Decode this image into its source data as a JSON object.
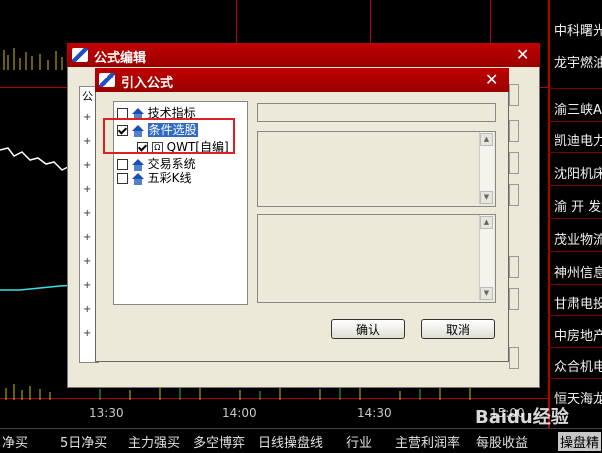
{
  "stock_list": [
    "中科曙光",
    "龙宇燃油",
    "渝三峡A",
    "凯迪电力",
    "沈阳机床",
    "渝 开 发",
    "茂业物流",
    "神州信息",
    "甘肃电投",
    "中房地产",
    "众合机电",
    "恒天海龙"
  ],
  "time_axis": [
    "13:30",
    "14:00",
    "14:30",
    "15:00"
  ],
  "bottom_tabs": [
    "净买",
    "5日净买",
    "主力强买",
    "多空博弈",
    "日线操盘线",
    "行业",
    "主营利润率",
    "每股收益",
    "操盘精"
  ],
  "outer_dialog": {
    "title": "公式编辑",
    "header_fragment": "公"
  },
  "inner_dialog": {
    "title": "引入公式",
    "tree": [
      {
        "label": "技术指标",
        "checked": false
      },
      {
        "label": "条件选股",
        "checked": true,
        "selected": true
      },
      {
        "label": "QWT[自编]",
        "checked": true,
        "child": true
      },
      {
        "label": "交易系统",
        "checked": false
      },
      {
        "label": "五彩K线",
        "checked": false
      }
    ],
    "confirm_label": "确认",
    "cancel_label": "取消"
  },
  "watermark": "Baidu经验",
  "colors": {
    "title_bar": "#b00000",
    "dialog_bg": "#ece9d8",
    "selection": "#316ac5",
    "highlight": "#e02020"
  }
}
